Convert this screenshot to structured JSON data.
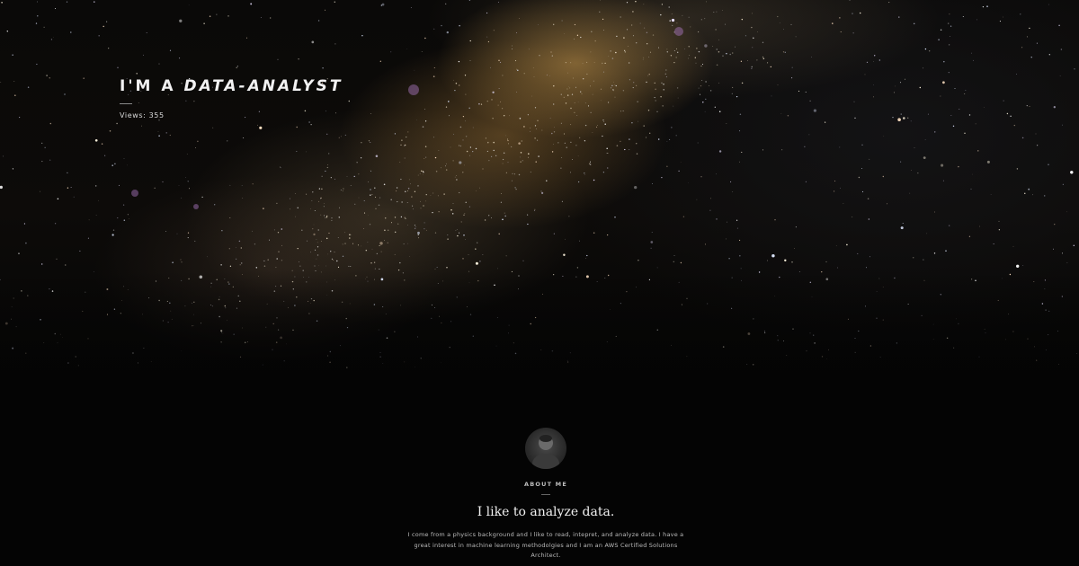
{
  "hero": {
    "title_prefix": "I'M A ",
    "title_accent": "DATA-ANALYST",
    "views": "Views: 355"
  },
  "about": {
    "label": "ABOUT ME",
    "heading": "I like to analyze data.",
    "body": "I come from a physics background and I like to read, intepret, and analyze data. I have a great interest in machine learning methodolgies and I am an AWS Certified Solutions Architect."
  },
  "colors": {
    "background": "#040404",
    "text_primary": "#f2f2f2",
    "text_secondary": "#bcbcbc",
    "nebula": "#c89a55"
  },
  "icons": {
    "avatar": "profile-photo"
  }
}
